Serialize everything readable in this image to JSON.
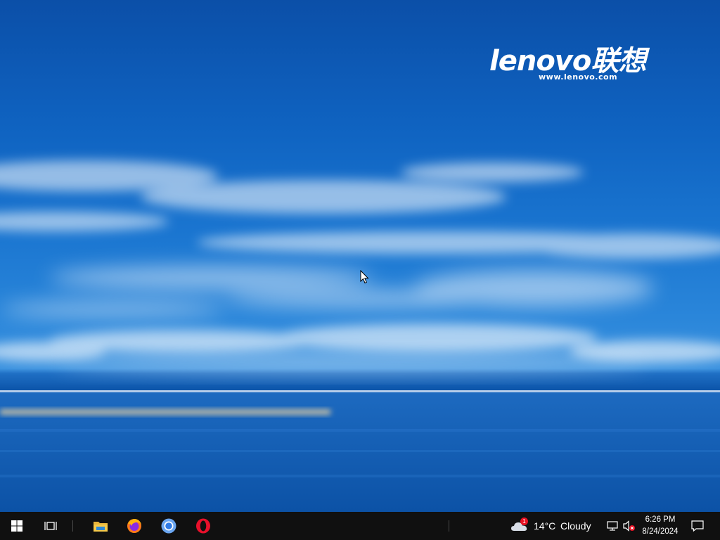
{
  "wallpaper": {
    "brand_logo": "lenovo联想",
    "brand_url": "www.lenovo.com"
  },
  "taskbar": {
    "start_icon": "windows-logo-icon",
    "task_view_icon": "task-view-icon",
    "pinned_apps": [
      {
        "name": "File Explorer",
        "icon": "folder-icon"
      },
      {
        "name": "Firefox",
        "icon": "firefox-icon"
      },
      {
        "name": "Chromium",
        "icon": "chromium-icon"
      },
      {
        "name": "Opera",
        "icon": "opera-icon"
      }
    ],
    "weather": {
      "temperature": "14°C",
      "condition": "Cloudy",
      "alert_badge": "1"
    },
    "tray": {
      "network_icon": "network-icon",
      "volume_icon": "volume-muted-icon"
    },
    "clock": {
      "time": "6:26 PM",
      "date": "8/24/2024"
    },
    "notification_icon": "action-center-icon"
  },
  "colors": {
    "sky_deep": "#0b4fa8",
    "sea": "#0d56ab",
    "taskbar": "#101010",
    "alert": "#e81123"
  }
}
